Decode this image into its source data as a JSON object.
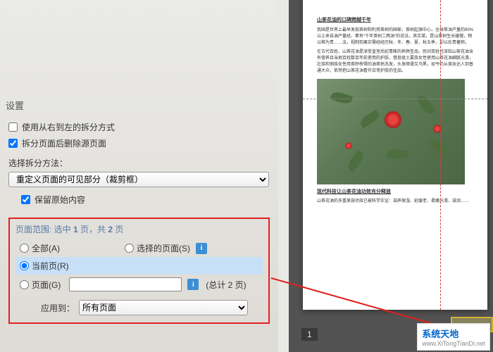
{
  "settings_header": "设置",
  "options": {
    "rtl_split": "使用从右到左的拆分方式",
    "delete_after": "拆分页面后删除源页面"
  },
  "method_label": "选择拆分方法：",
  "method_selected": "重定义页面的可见部分（裁剪框）",
  "keep_original": "保留原始内容",
  "range": {
    "title_prefix": "页面范围: 选中 ",
    "title_count1": "1",
    "title_mid": " 页，共 ",
    "title_count2": "2",
    "title_suffix": " 页",
    "all": "全部(A)",
    "selected": "选择的页面(S)",
    "current": "当前页(R)",
    "pages": "页面(G)",
    "total": "(总计 2 页)",
    "apply_label": "应用到：",
    "apply_value": "所有页面"
  },
  "doc": {
    "h1": "山茶花油的口碑跨越千年",
    "p1": "我国是世界上最早发现茶树和利用茶树的国家，茶树起源中心，全球茶油产量的90%以上来自油产量经，素有\"千年茶树二两油\"的说法，其实菜，是山茶树生长缓慢，物以稀为贵……法，视制到果实需经经历秋、冬、春、夏、秋五季，却以珍贵著称。",
    "p2": "在古代百姓，山茶花油是深受皇室后妃青睐的养颜圣品，民间百姓也深知山茶花油含有营养且当地百姓数百年前使用的护肤，借息驱土要族女性使用山茶花油细腻光滑，壮族和侗族女性用茶籽榨得的油茶枯洗发，头发顺滑又乌黑，如今仍从美妆达人到普通大众，依然把山茶花油看作日常护肤的佳品。",
    "h2": "现代科技让山茶花油功效充分释放",
    "p3": "山茶花油的多重美容功效已被科学实证：滋养保湿、延缓老、柔嫩光滑、滋润……"
  },
  "page_number": "1",
  "watermark": {
    "name": "系统天地",
    "url": "www.XiTongTianDi.net"
  }
}
